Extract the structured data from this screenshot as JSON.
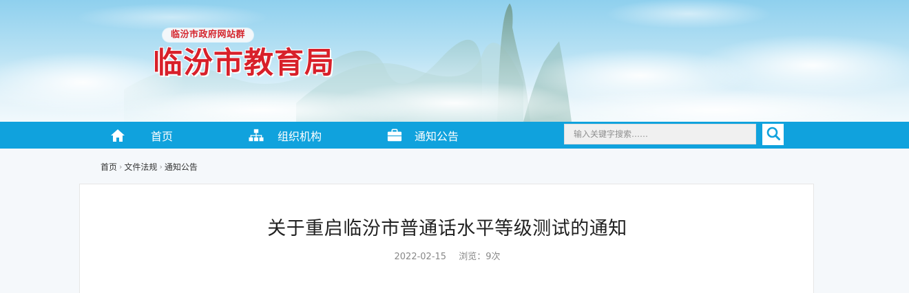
{
  "header": {
    "site_group": "临汾市政府网站群",
    "site_title": "临汾市教育局"
  },
  "nav": {
    "items": [
      {
        "label": "首页",
        "icon": "home-icon"
      },
      {
        "label": "组织机构",
        "icon": "org-chart-icon"
      },
      {
        "label": "通知公告",
        "icon": "briefcase-icon"
      }
    ],
    "search": {
      "placeholder": "输入关键字搜索……",
      "button_icon": "search-icon"
    }
  },
  "breadcrumb": {
    "items": [
      "首页",
      "文件法规",
      "通知公告"
    ]
  },
  "article": {
    "title": "关于重启临汾市普通话水平等级测试的通知",
    "date": "2022-02-15",
    "views": "浏览：9次"
  },
  "colors": {
    "nav_bg": "#10a2dd",
    "title_red": "#d8202a"
  }
}
